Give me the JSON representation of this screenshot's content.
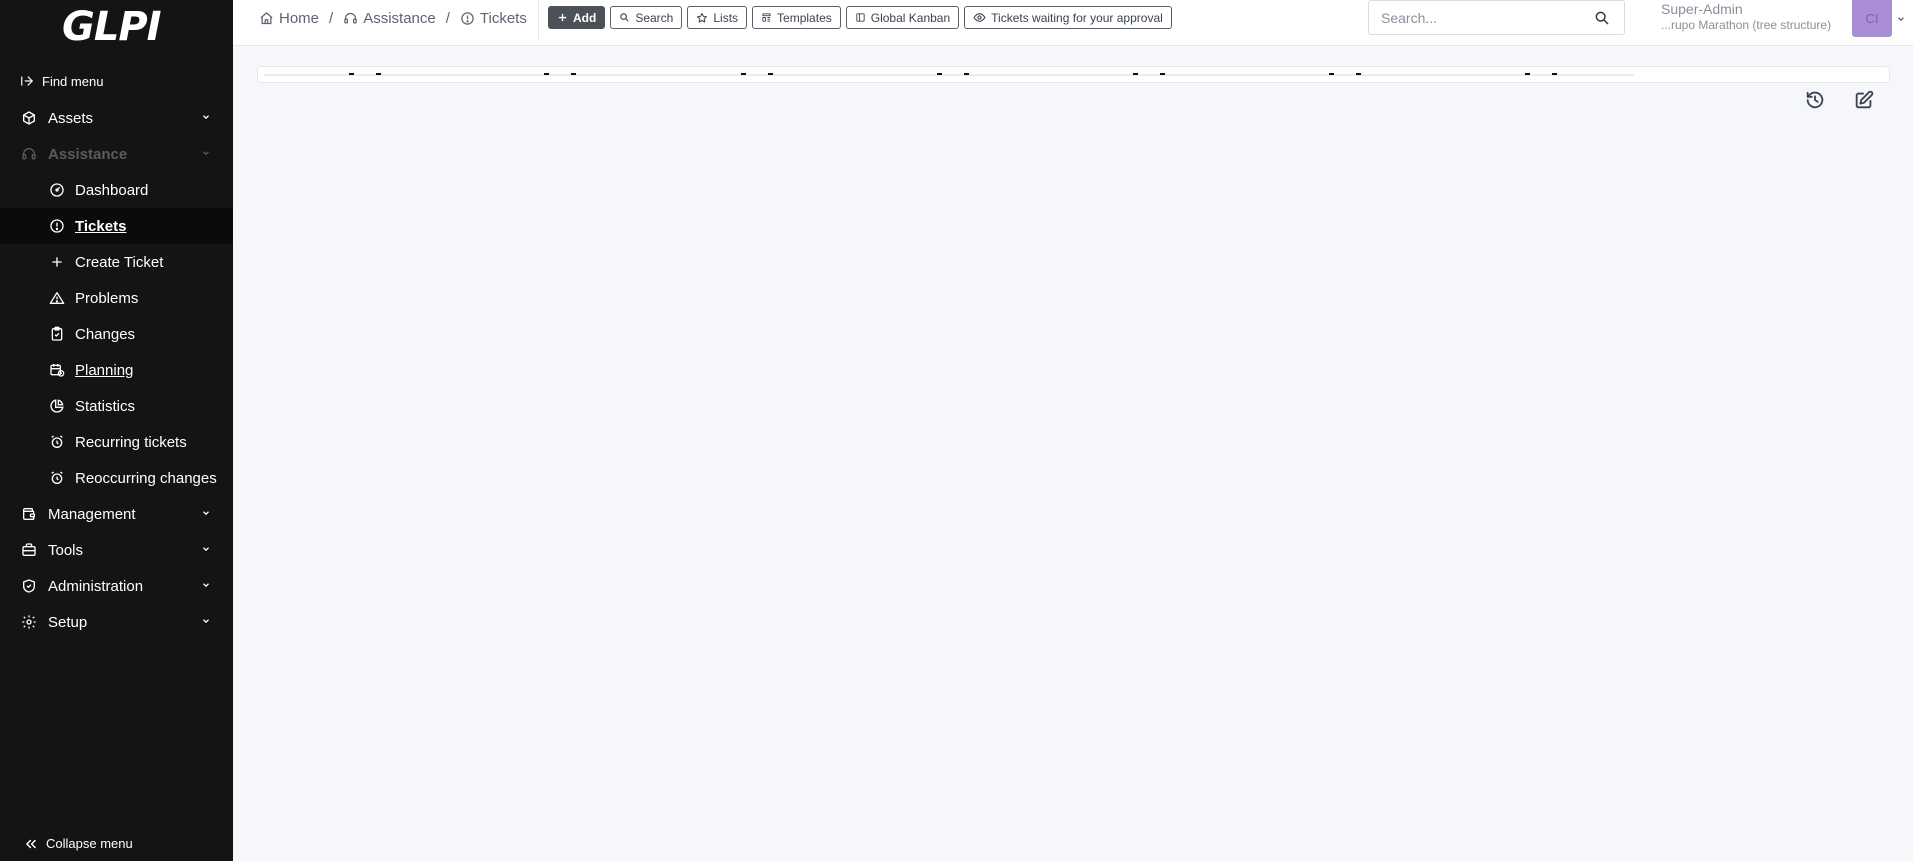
{
  "app": {
    "logo_text": "GLPI"
  },
  "sidebar": {
    "find_menu": "Find menu",
    "items": [
      {
        "label": "Assets",
        "icon": "box-icon",
        "level": "top",
        "state": "collapsed"
      },
      {
        "label": "Assistance",
        "icon": "headset-icon",
        "level": "top",
        "state": "expanded"
      },
      {
        "label": "Dashboard",
        "icon": "gauge-icon",
        "level": "sub"
      },
      {
        "label": "Tickets",
        "icon": "alert-circle-icon",
        "level": "sub",
        "state": "active"
      },
      {
        "label": "Create Ticket",
        "icon": "plus-icon",
        "level": "sub"
      },
      {
        "label": "Problems",
        "icon": "warning-triangle-icon",
        "level": "sub"
      },
      {
        "label": "Changes",
        "icon": "clipboard-check-icon",
        "level": "sub"
      },
      {
        "label": "Planning",
        "icon": "calendar-time-icon",
        "level": "sub"
      },
      {
        "label": "Statistics",
        "icon": "chart-pie-icon",
        "level": "sub"
      },
      {
        "label": "Recurring tickets",
        "icon": "alarm-clock-icon",
        "level": "sub"
      },
      {
        "label": "Reoccurring changes",
        "icon": "alarm-clock-icon",
        "level": "sub"
      },
      {
        "label": "Management",
        "icon": "wallet-icon",
        "level": "top",
        "state": "collapsed"
      },
      {
        "label": "Tools",
        "icon": "briefcase-icon",
        "level": "top",
        "state": "collapsed"
      },
      {
        "label": "Administration",
        "icon": "shield-check-icon",
        "level": "top",
        "state": "collapsed"
      },
      {
        "label": "Setup",
        "icon": "gear-icon",
        "level": "top",
        "state": "collapsed"
      }
    ],
    "collapse_menu": "Collapse menu"
  },
  "header": {
    "breadcrumb": [
      {
        "label": "Home",
        "icon": "home-icon"
      },
      {
        "label": "Assistance",
        "icon": "headset-icon"
      },
      {
        "label": "Tickets",
        "icon": "alert-circle-icon"
      }
    ],
    "toolbar": [
      {
        "label": "Add",
        "icon": "plus-icon",
        "primary": true
      },
      {
        "label": "Search",
        "icon": "search-icon"
      },
      {
        "label": "Lists",
        "icon": "star-icon"
      },
      {
        "label": "Templates",
        "icon": "template-icon"
      },
      {
        "label": "Global Kanban",
        "icon": "kanban-icon"
      },
      {
        "label": "Tickets waiting for your approval",
        "icon": "eye-icon"
      }
    ],
    "search": {
      "placeholder": "Search...",
      "value": ""
    },
    "user": {
      "name": "Super-Admin",
      "entity": "...rupo Marathon (tree structure)",
      "initials": "CI"
    }
  },
  "main": {
    "actions": [
      {
        "name": "history-icon"
      },
      {
        "name": "edit-icon"
      }
    ]
  },
  "colors": {
    "sidebar_bg": "#141414",
    "page_bg": "#f5f7fb",
    "avatar_bg": "#a98ed6",
    "primary_btn": "#4b5059"
  }
}
